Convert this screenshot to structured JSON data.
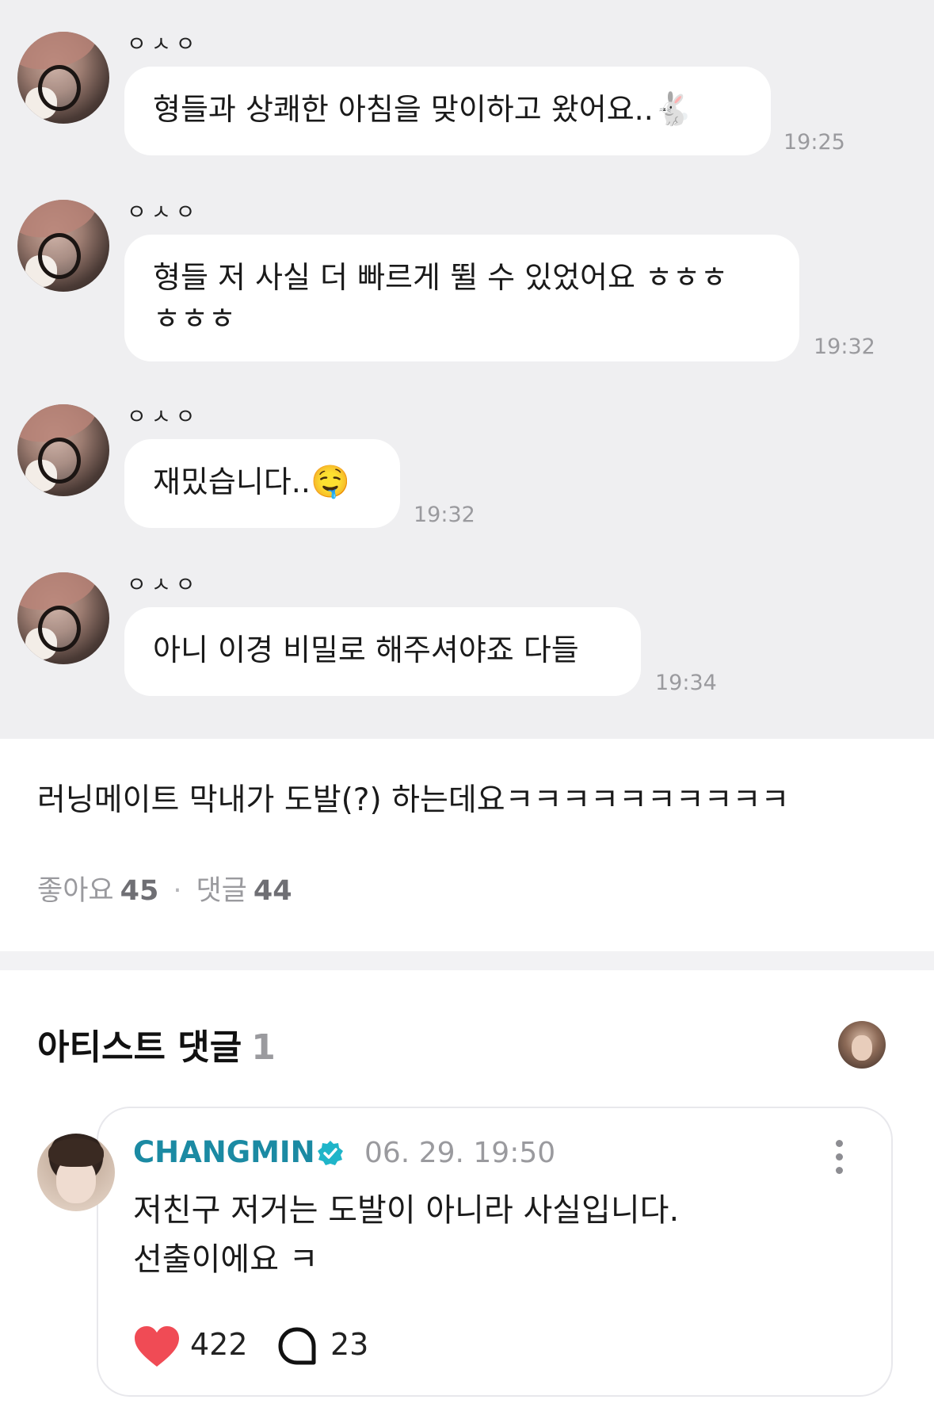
{
  "chat": {
    "messages": [
      {
        "sender": "ㅇㅅㅇ",
        "text": "형들과 상쾌한 아침을 맞이하고 왔어요..",
        "emoji": "🐇",
        "time": "19:25"
      },
      {
        "sender": "ㅇㅅㅇ",
        "line1": "형들 저 사실 더 빠르게 뛸 수 있었어요 ㅎㅎㅎ",
        "line2": "ㅎㅎㅎ",
        "time": "19:32"
      },
      {
        "sender": "ㅇㅅㅇ",
        "text": "재밌습니다..",
        "emoji": "🤤",
        "time": "19:32"
      },
      {
        "sender": "ㅇㅅㅇ",
        "text": "아니 이경 비밀로 해주셔야죠 다들",
        "time": "19:34"
      }
    ]
  },
  "post": {
    "text": "러닝메이트 막내가 도발(?) 하는데요ㅋㅋㅋㅋㅋㅋㅋㅋㅋㅋ",
    "likes_label": "좋아요",
    "likes_count": "45",
    "separator": "·",
    "comments_label": "댓글",
    "comments_count": "44"
  },
  "artist_comments": {
    "title": "아티스트 댓글",
    "count": "1",
    "comment": {
      "author": "CHANGMIN",
      "date": "06. 29. 19:50",
      "line1": "저친구 저거는 도발이 아니라 사실입니다.",
      "line2": "선출이에요 ㅋ",
      "likes": "422",
      "replies": "23"
    }
  },
  "colors": {
    "chat_background": "#efeff1",
    "author_name": "#1b8aa3",
    "heart": "#f04b55",
    "verified_badge": "#1fb5c9"
  }
}
